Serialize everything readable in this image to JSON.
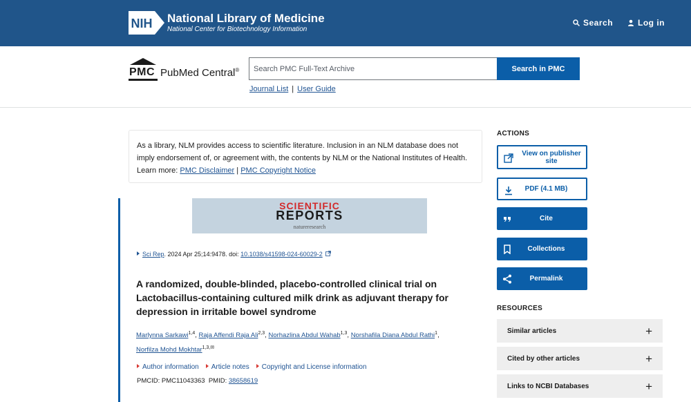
{
  "nlm": {
    "logo_text": "NIH",
    "title": "National Library of Medicine",
    "subtitle": "National Center for Biotechnology Information",
    "search_label": "Search",
    "login_label": "Log in"
  },
  "pmc": {
    "logo_letters": "PMC",
    "name": "PubMed Central",
    "registered": "®",
    "search_placeholder": "Search PMC Full-Text Archive",
    "search_button": "Search in PMC",
    "journal_list": "Journal List",
    "separator": "|",
    "user_guide": "User Guide"
  },
  "disclaimer": {
    "text": "As a library, NLM provides access to scientific literature. Inclusion in an NLM database does not imply endorsement of, or agreement with, the contents by NLM or the National Institutes of Health.",
    "learn_more": "Learn more:",
    "link1": "PMC Disclaimer",
    "sep": "|",
    "link2": "PMC Copyright Notice"
  },
  "journal_banner": {
    "line1": "SCIENTIFIC",
    "line2": "REPORTS",
    "line3": "natureresearch"
  },
  "citation": {
    "journal": "Sci Rep",
    "details": ". 2024 Apr 25;14:9478. doi: ",
    "doi": "10.1038/s41598-024-60029-2"
  },
  "article": {
    "title": "A randomized, double-blinded, placebo-controlled clinical trial on Lactobacillus-containing cultured milk drink as adjuvant therapy for depression in irritable bowel syndrome"
  },
  "authors": [
    {
      "name": "Marlynna Sarkawi",
      "sup": "1,4"
    },
    {
      "name": "Raja Affendi Raja Ali",
      "sup": "2,3"
    },
    {
      "name": "Norhazlina Abdul Wahab",
      "sup": "1,3"
    },
    {
      "name": "Norshafila Diana Abdul Rathi",
      "sup": "1"
    },
    {
      "name": "Norfilza Mohd Mokhtar",
      "sup": "1,3,✉"
    }
  ],
  "info_links": [
    "Author information",
    "Article notes",
    "Copyright and License information"
  ],
  "ids": {
    "pmcid_label": "PMCID: PMC11043363",
    "pmid_label": "PMID:",
    "pmid": "38658619"
  },
  "sidebar": {
    "actions_heading": "ACTIONS",
    "actions": [
      {
        "label": "View on publisher site",
        "icon": "external-link-icon"
      },
      {
        "label": "PDF (4.1 MB)",
        "icon": "download-icon"
      },
      {
        "label": "Cite",
        "icon": "quote-icon"
      },
      {
        "label": "Collections",
        "icon": "bookmark-icon"
      },
      {
        "label": "Permalink",
        "icon": "share-icon"
      }
    ],
    "resources_heading": "RESOURCES",
    "resources": [
      {
        "label": "Similar articles"
      },
      {
        "label": "Cited by other articles"
      },
      {
        "label": "Links to NCBI Databases"
      }
    ],
    "plus": "+"
  },
  "colors": {
    "nlm_blue": "#20558a",
    "primary": "#0b5ea8",
    "accent_red": "#d83933"
  }
}
